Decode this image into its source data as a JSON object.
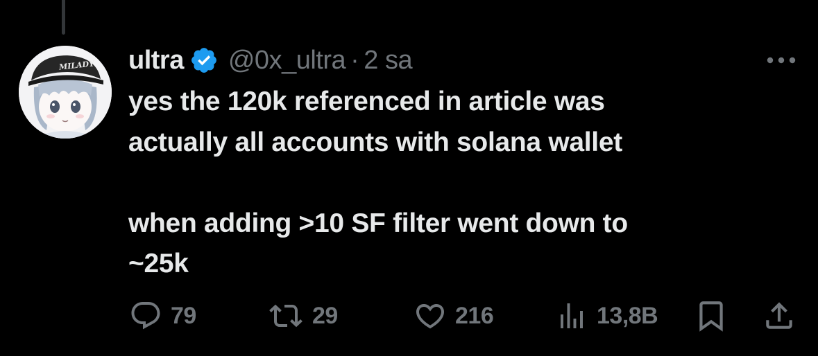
{
  "colors": {
    "background": "#000000",
    "text_primary": "#e7e9ea",
    "text_secondary": "#71767b",
    "verified_badge": "#1d9bf0",
    "thread_line": "#333639"
  },
  "author": {
    "display_name": "ultra",
    "handle": "@0x_ultra",
    "separator": "·",
    "timestamp": "2 sa",
    "verified": true,
    "avatar_cap_text": "MILADY"
  },
  "more_menu": {
    "icon": "more-horizontal-icon"
  },
  "tweet": {
    "paragraph_1_line_1": "yes the 120k referenced in article was",
    "paragraph_1_line_2": "actually all accounts with solana wallet",
    "paragraph_2_line_1": "when adding >10 SF filter went down to",
    "paragraph_2_line_2": "~25k"
  },
  "actions": {
    "reply": {
      "icon": "reply-icon",
      "count": "79"
    },
    "retweet": {
      "icon": "retweet-icon",
      "count": "29"
    },
    "like": {
      "icon": "heart-icon",
      "count": "216"
    },
    "views": {
      "icon": "views-chart-icon",
      "count": "13,8B"
    },
    "bookmark": {
      "icon": "bookmark-icon"
    },
    "share": {
      "icon": "share-icon"
    }
  }
}
